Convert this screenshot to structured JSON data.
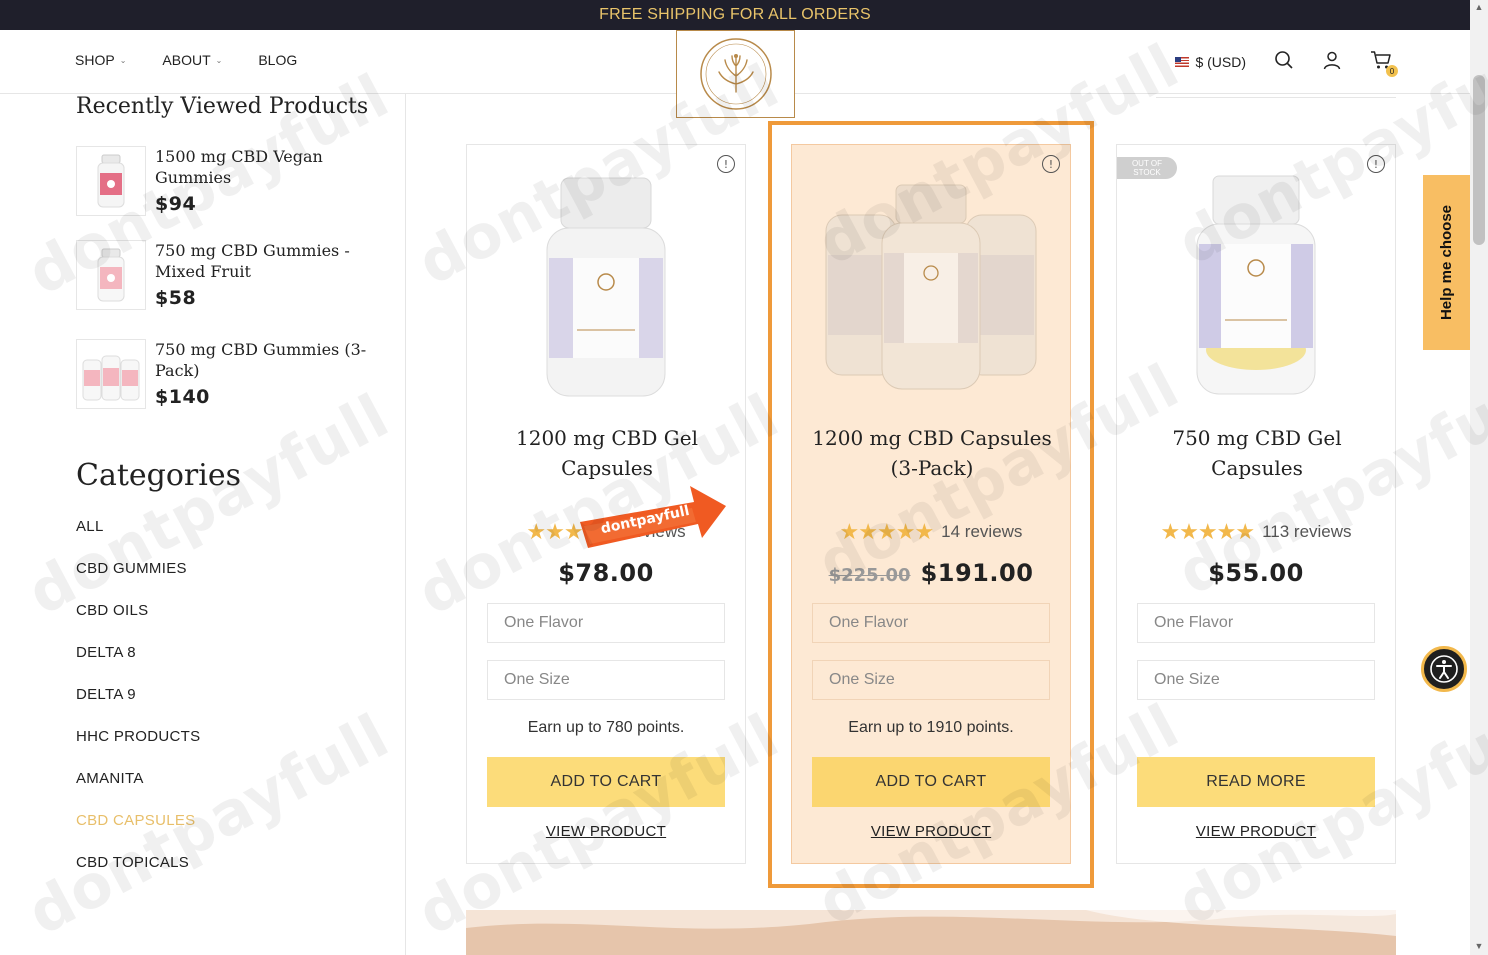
{
  "topbar": {
    "text": "FREE SHIPPING FOR ALL ORDERS"
  },
  "nav": {
    "shop": "SHOP",
    "about": "ABOUT",
    "blog": "BLOG"
  },
  "header": {
    "currency": "$ (USD)",
    "cart_count": "0"
  },
  "sidebar": {
    "recent_title": "Recently Viewed Products",
    "recent": [
      {
        "name": "1500 mg CBD Vegan Gummies",
        "price": "$94"
      },
      {
        "name": "750 mg CBD Gummies - Mixed Fruit",
        "price": "$58"
      },
      {
        "name": "750 mg CBD Gummies (3-Pack)",
        "price": "$140"
      }
    ],
    "categories_title": "Categories",
    "categories": [
      "ALL",
      "CBD GUMMIES",
      "CBD OILS",
      "DELTA 8",
      "DELTA 9",
      "HHC PRODUCTS",
      "AMANITA",
      "CBD CAPSULES",
      "CBD TOPICALS"
    ],
    "active_category": "CBD CAPSULES"
  },
  "products": [
    {
      "name": "1200 mg CBD Gel Capsules",
      "reviews": "reviews",
      "rating": 5,
      "price": "$78.00",
      "old_price": "",
      "flavor": "One Flavor",
      "size": "One Size",
      "points": "Earn up to 780 points.",
      "button": "ADD TO CART",
      "view": "VIEW PRODUCT"
    },
    {
      "name": "1200 mg CBD Capsules (3-Pack)",
      "reviews": "14 reviews",
      "rating": 5,
      "price": "$191.00",
      "old_price": "$225.00",
      "flavor": "One Flavor",
      "size": "One Size",
      "points": "Earn up to 1910 points.",
      "button": "ADD TO CART",
      "view": "VIEW PRODUCT"
    },
    {
      "name": "750 mg CBD Gel Capsules",
      "reviews": "113 reviews",
      "rating": 5,
      "price": "$55.00",
      "old_price": "",
      "flavor": "One Flavor",
      "size": "One Size",
      "points": "",
      "button": "READ MORE",
      "view": "VIEW PRODUCT",
      "badge": "OUT OF STOCK"
    }
  ],
  "help_tab": "Help me choose",
  "watermark": "dontpayfull",
  "colors": {
    "accent": "#f8be63",
    "highlight_border": "#ef9a3a",
    "topbar_bg": "#1f1f2b",
    "active_category": "#e8bf6a"
  }
}
